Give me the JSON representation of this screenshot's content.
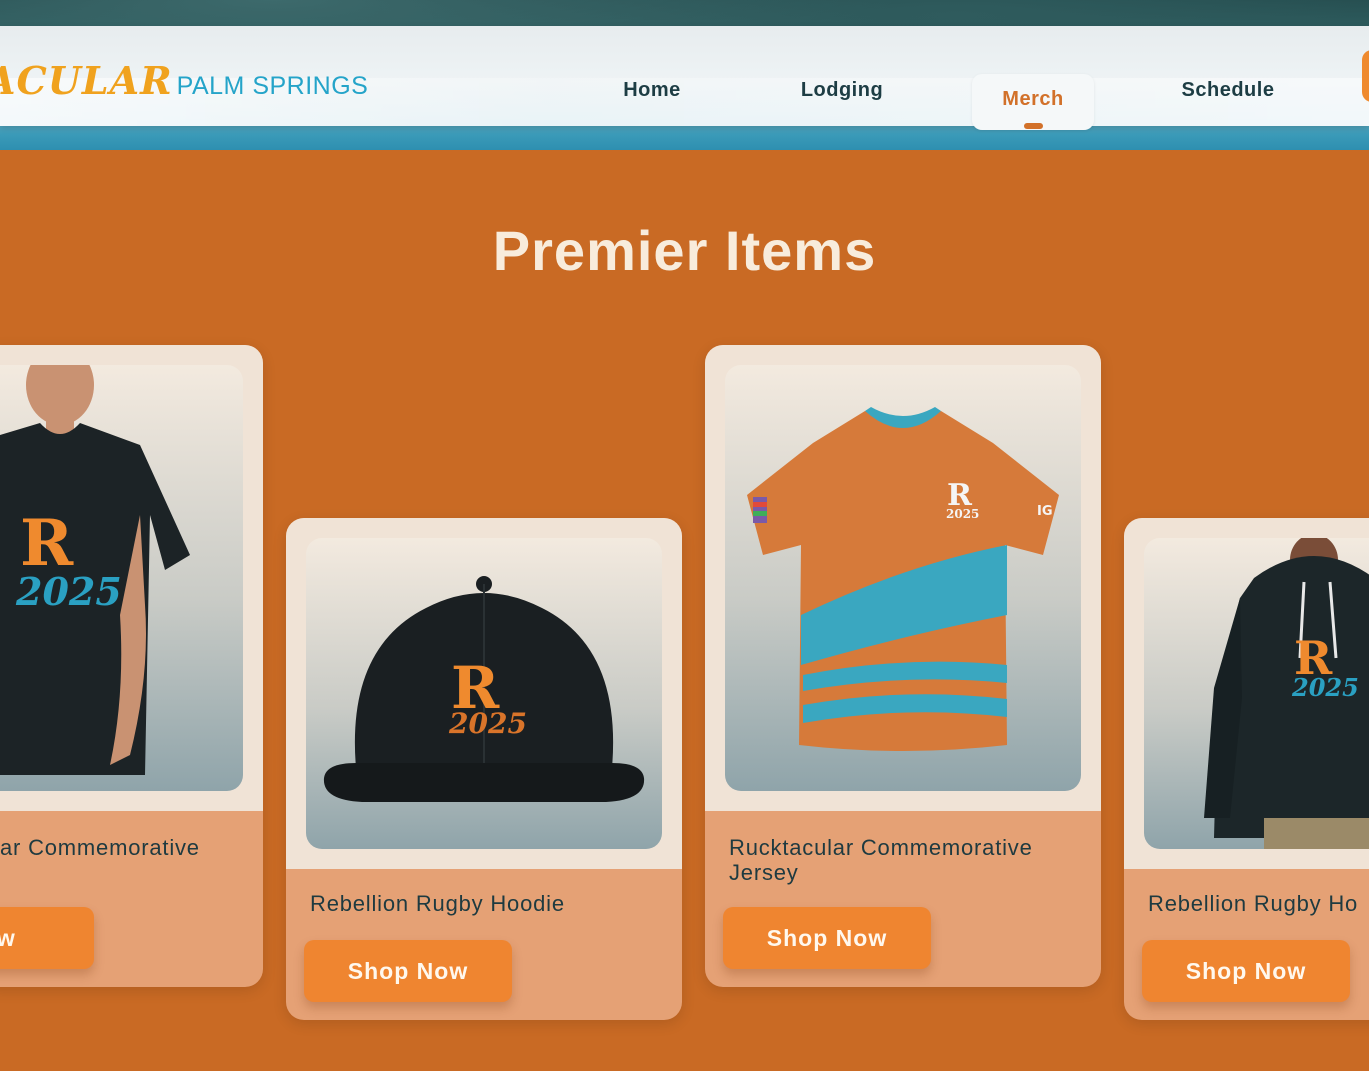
{
  "header": {
    "logo_main": "ACULAR",
    "logo_sub": "PALM SPRINGS",
    "nav": [
      {
        "label": "Home"
      },
      {
        "label": "Lodging"
      },
      {
        "label": "Merch",
        "active": true
      },
      {
        "label": "Schedule"
      }
    ]
  },
  "main": {
    "title": "Premier Items",
    "products": [
      {
        "title": "ar Commemorative",
        "button": "Now",
        "image": "t-shirt-icon"
      },
      {
        "title": "Rebellion Rugby Hoodie",
        "button": "Shop Now",
        "image": "cap-icon"
      },
      {
        "title_line1": "Rucktacular Commemorative",
        "title_line2": "Jersey",
        "button": "Shop Now",
        "image": "jersey-icon"
      },
      {
        "title": "Rebellion Rugby Ho",
        "button": "Shop Now",
        "image": "hoodie-icon"
      }
    ]
  },
  "colors": {
    "background": "#c96a24",
    "accent": "#ef8530",
    "nav_active": "#d2712a",
    "text_dark": "#1e3a40"
  }
}
